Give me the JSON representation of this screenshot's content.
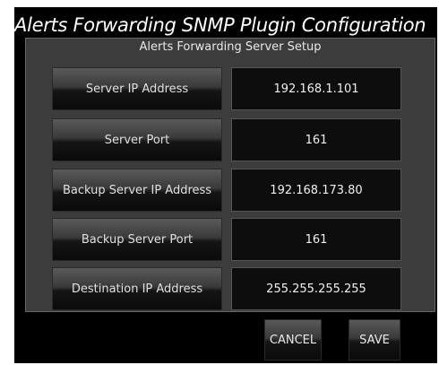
{
  "title": "Alerts Forwarding SNMP Plugin Configuration",
  "panel": {
    "title": "Alerts Forwarding Server Setup",
    "rows": [
      {
        "label": "Server IP Address",
        "value": "192.168.1.101"
      },
      {
        "label": "Server Port",
        "value": "161"
      },
      {
        "label": "Backup Server IP Address",
        "value": "192.168.173.80"
      },
      {
        "label": "Backup Server Port",
        "value": "161"
      },
      {
        "label": "Destination IP Address",
        "value": "255.255.255.255"
      }
    ]
  },
  "actions": {
    "cancel_label": "CANCEL",
    "save_label": "SAVE"
  },
  "colors": {
    "background": "#000000",
    "panel": "#3c3c3c",
    "field": "#0d0d0d",
    "text": "#ffffff"
  }
}
